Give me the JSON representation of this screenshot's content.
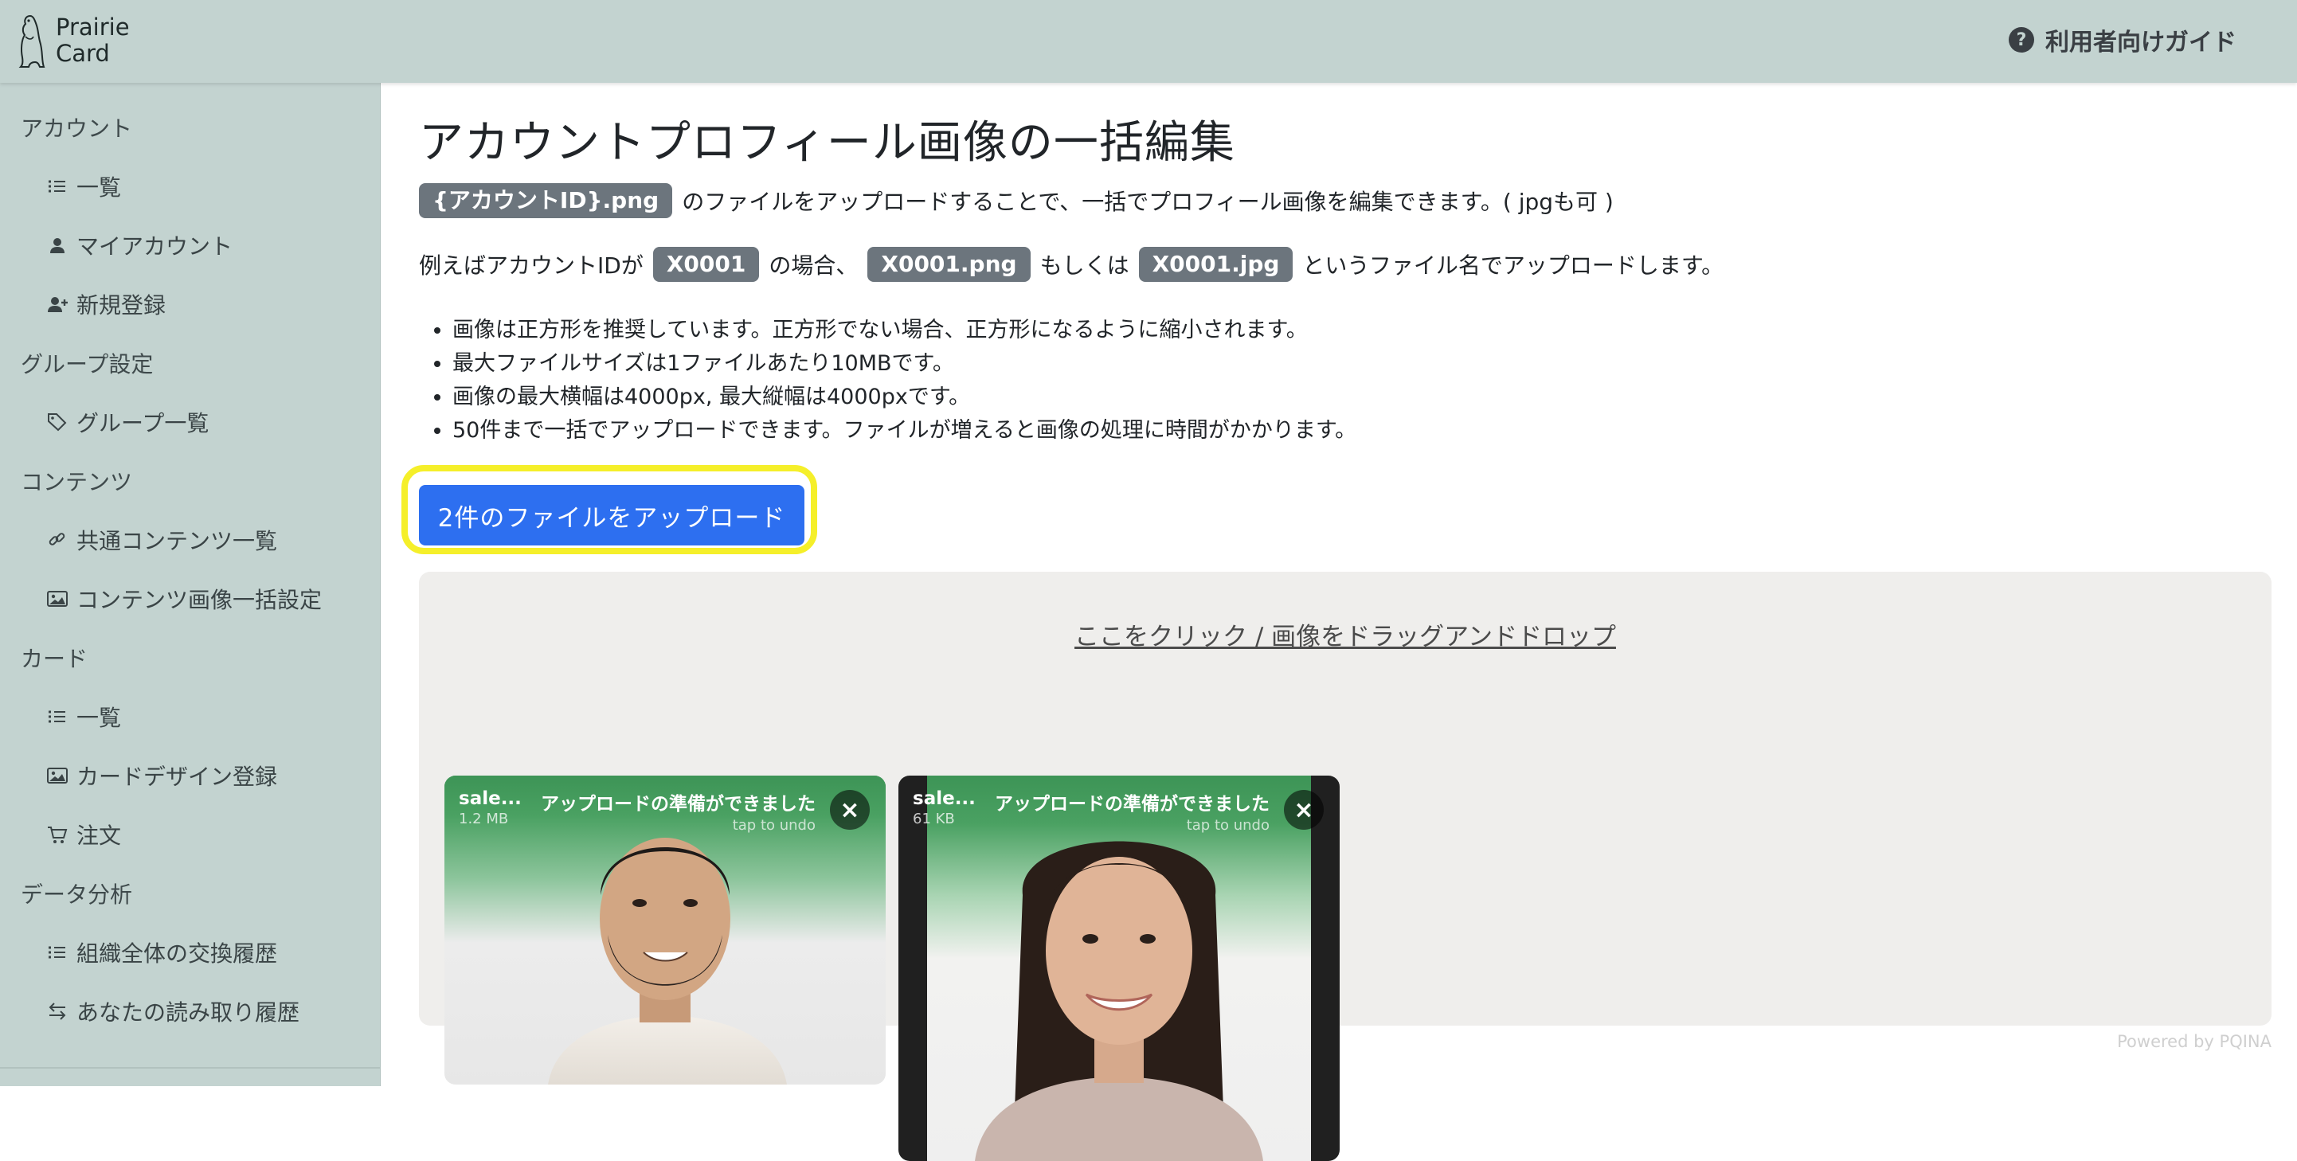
{
  "header": {
    "logo_line1": "Prairie",
    "logo_line2": "Card",
    "guide_icon": "question-circle-icon",
    "guide_label": "利用者向けガイド"
  },
  "sidebar": {
    "sections": [
      {
        "label": "アカウント",
        "items": [
          {
            "icon": "list-icon",
            "label": "一覧"
          },
          {
            "icon": "person-icon",
            "label": "マイアカウント"
          },
          {
            "icon": "person-add-icon",
            "label": "新規登録"
          }
        ]
      },
      {
        "label": "グループ設定",
        "items": [
          {
            "icon": "tags-icon",
            "label": "グループ一覧"
          }
        ]
      },
      {
        "label": "コンテンツ",
        "items": [
          {
            "icon": "link-icon",
            "label": "共通コンテンツ一覧"
          },
          {
            "icon": "image-icon",
            "label": "コンテンツ画像一括設定"
          }
        ]
      },
      {
        "label": "カード",
        "items": [
          {
            "icon": "list-icon",
            "label": "一覧"
          },
          {
            "icon": "image-icon",
            "label": "カードデザイン登録"
          },
          {
            "icon": "cart-icon",
            "label": "注文"
          }
        ]
      },
      {
        "label": "データ分析",
        "items": [
          {
            "icon": "list-icon",
            "label": "組織全体の交換履歴"
          },
          {
            "icon": "arrows-swap-icon",
            "label": "あなたの読み取り履歴"
          }
        ]
      }
    ]
  },
  "main": {
    "title": "アカウントプロフィール画像の一括編集",
    "line1": {
      "code": "{アカウントID}.png",
      "text": "のファイルをアップロードすることで、一括でプロフィール画像を編集できます。( jpgも可 )"
    },
    "line2": {
      "prefix": "例えばアカウントIDが",
      "code1": "X0001",
      "mid1": "の場合、",
      "code2": "X0001.png",
      "mid2": "もしくは",
      "code3": "X0001.jpg",
      "suffix": "というファイル名でアップロードします。"
    },
    "bullets": [
      "画像は正方形を推奨しています。正方形でない場合、正方形になるように縮小されます。",
      "最大ファイルサイズは1ファイルあたり10MBです。",
      "画像の最大横幅は4000px, 最大縦幅は4000pxです。",
      "50件まで一括でアップロードできます。ファイルが増えると画像の処理に時間がかかります。"
    ],
    "upload_button": "2件のファイルをアップロード",
    "dropzone_label": "ここをクリック / 画像をドラッグアンドドロップ",
    "files": [
      {
        "name": "sale...",
        "size": "1.2 MB",
        "status": "アップロードの準備ができました",
        "sub": "tap to undo"
      },
      {
        "name": "sale...",
        "size": "61 KB",
        "status": "アップロードの準備ができました",
        "sub": "tap to undo"
      }
    ],
    "powered_by": "Powered by PQINA"
  }
}
